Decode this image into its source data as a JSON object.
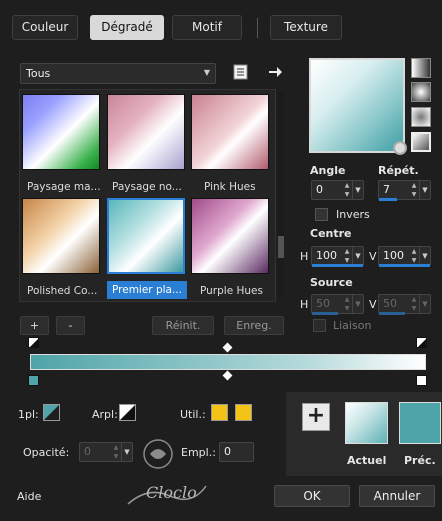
{
  "tabs": [
    {
      "label": "Couleur"
    },
    {
      "label": "Dégradé"
    },
    {
      "label": "Motif"
    },
    {
      "label": "Texture"
    }
  ],
  "active_tab": "Dégradé",
  "category": {
    "selected": "Tous"
  },
  "gradients": [
    {
      "name": "Paysage ma..."
    },
    {
      "name": "Paysage no..."
    },
    {
      "name": "Pink Hues"
    },
    {
      "name": "Polished Co..."
    },
    {
      "name": "Premier pla..."
    },
    {
      "name": "Purple Hues"
    }
  ],
  "list_buttons": {
    "add": "+",
    "remove": "-",
    "reset": "Réinit.",
    "save": "Enreg."
  },
  "props": {
    "angle_label": "Angle",
    "angle_value": "0",
    "repeat_label": "Répét.",
    "repeat_value": "7",
    "invert_label": "Invers",
    "center_label": "Centre",
    "center_h_label": "H",
    "center_h_value": "100",
    "center_v_label": "V",
    "center_v_value": "100",
    "source_label": "Source",
    "source_h_label": "H",
    "source_h_value": "50",
    "source_v_label": "V",
    "source_v_value": "50",
    "link_label": "Liaison"
  },
  "stops": {
    "first_label": "1pl:",
    "arpl_label": "Arpl:",
    "util_label": "Util.:",
    "opacity_label": "Opacité:",
    "opacity_value": "0",
    "empl_label": "Empl.:",
    "empl_value": "0"
  },
  "bottom": {
    "current_label": "Actuel",
    "previous_label": "Préc.",
    "help_label": "Aide",
    "ok_label": "OK",
    "cancel_label": "Annuler",
    "watermark": "Cloclo"
  },
  "colors": {
    "accent": "#2a7fd4",
    "teal": "#4ea4a8",
    "yellow": "#f3c316",
    "bg": "#1e1e1e"
  }
}
